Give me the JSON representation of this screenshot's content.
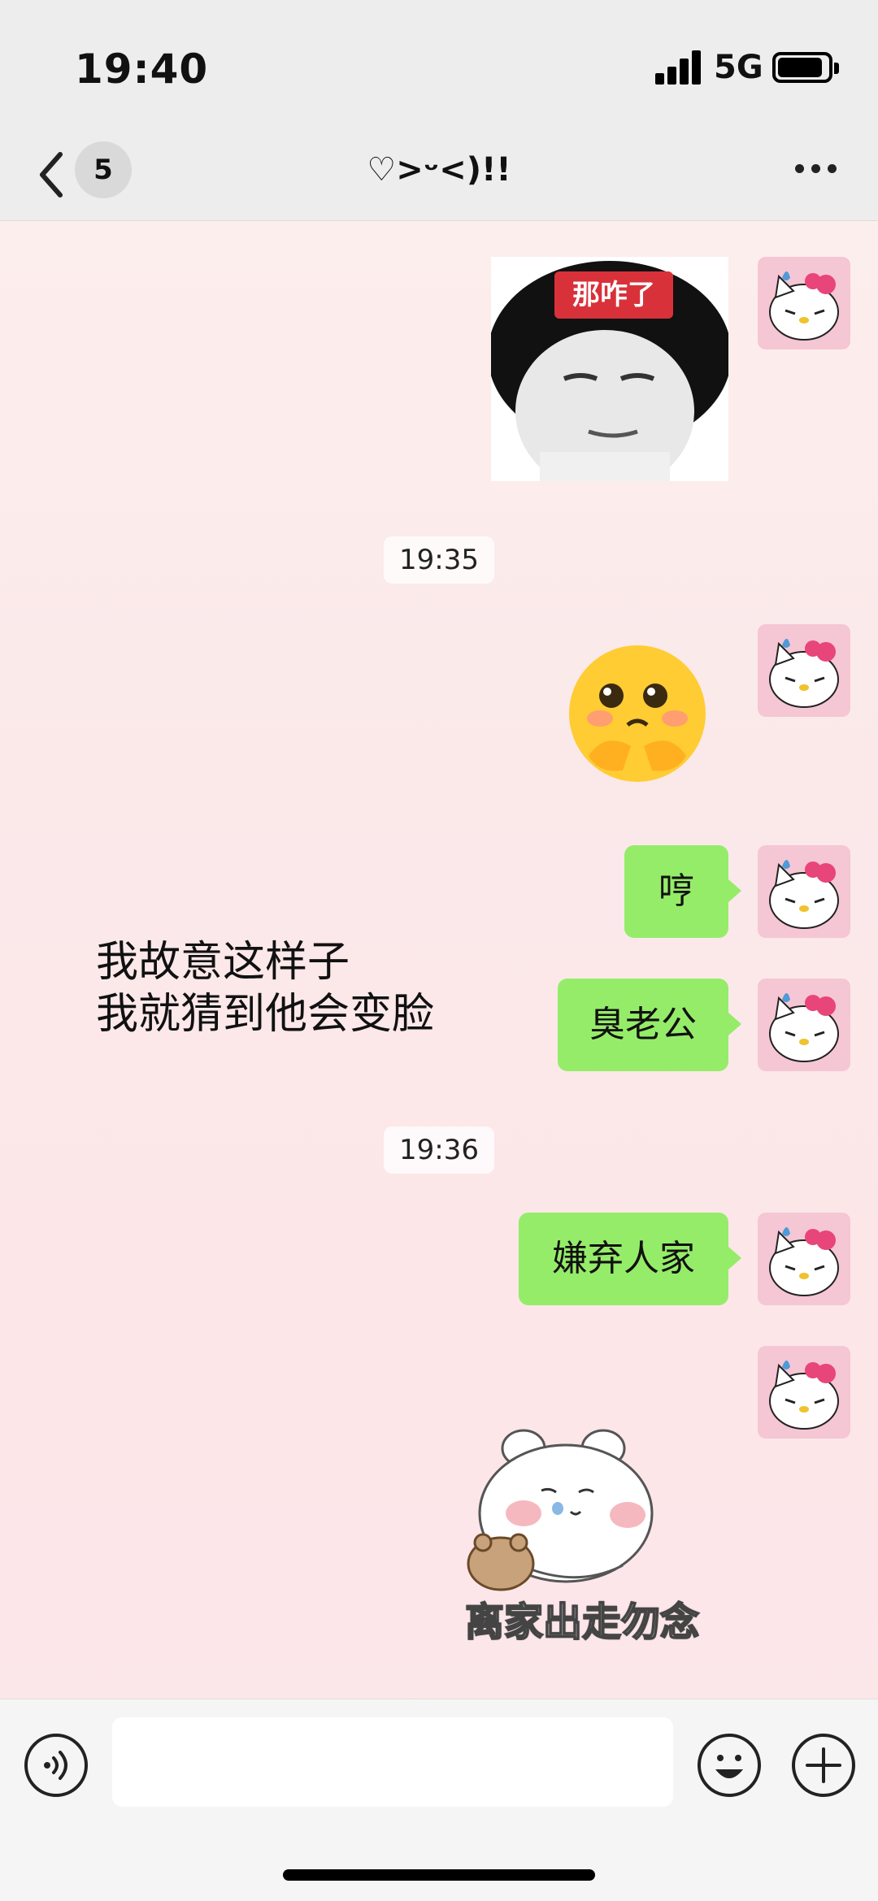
{
  "status_bar": {
    "time": "19:40",
    "network": "5G",
    "battery_level": 0.9
  },
  "nav": {
    "unread_count": "5",
    "title": "♡>ᵕ<)!!"
  },
  "messages": [
    {
      "type": "sticker",
      "caption": "那咋了"
    },
    {
      "type": "timestamp",
      "text": "19:35"
    },
    {
      "type": "emoji",
      "icon": "shy-face-emoji"
    },
    {
      "type": "text",
      "text": "哼"
    },
    {
      "type": "text",
      "text": "臭老公"
    },
    {
      "type": "timestamp",
      "text": "19:36"
    },
    {
      "type": "text",
      "text": "嫌弃人家"
    },
    {
      "type": "sticker",
      "caption": "离家出走勿念"
    }
  ],
  "overlay_caption": {
    "line1": "我故意这样子",
    "line2": "我就猜到他会变脸"
  },
  "input": {
    "placeholder": "",
    "value": ""
  },
  "colors": {
    "bubble": "#95ec69",
    "bar_bg": "#ededed",
    "avatar_bg": "#f5c6d4"
  }
}
